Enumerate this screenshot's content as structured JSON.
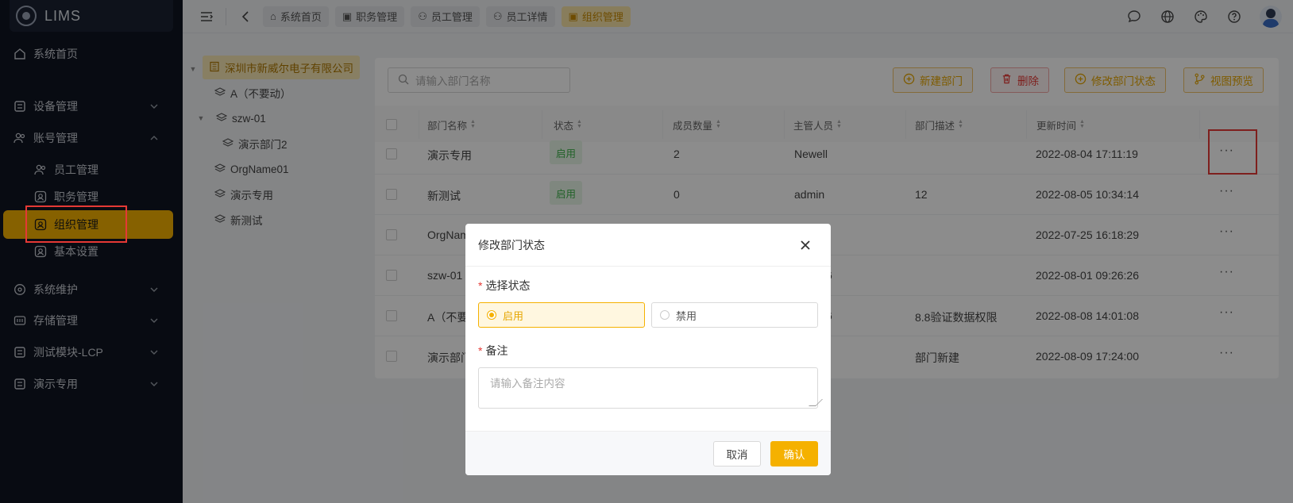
{
  "app": {
    "name": "LIMS"
  },
  "sidebar": {
    "items": [
      {
        "label": "系统首页",
        "icon": "home-icon"
      },
      {
        "label": "设备管理",
        "icon": "grid-icon"
      },
      {
        "label": "账号管理",
        "icon": "users-icon"
      },
      {
        "label": "员工管理",
        "icon": "users-icon"
      },
      {
        "label": "职务管理",
        "icon": "id-card-icon"
      },
      {
        "label": "组织管理",
        "icon": "id-card-icon"
      },
      {
        "label": "基本设置",
        "icon": "id-card-icon"
      },
      {
        "label": "系统维护",
        "icon": "settings-icon"
      },
      {
        "label": "存储管理",
        "icon": "storage-icon"
      },
      {
        "label": "测试模块-LCP",
        "icon": "grid-icon"
      },
      {
        "label": "演示专用",
        "icon": "grid-icon"
      }
    ],
    "active": "组织管理"
  },
  "tabs": [
    {
      "label": "系统首页",
      "icon": "home-icon"
    },
    {
      "label": "职务管理",
      "icon": "id-card-icon"
    },
    {
      "label": "员工管理",
      "icon": "users-icon"
    },
    {
      "label": "员工详情",
      "icon": "users-icon"
    },
    {
      "label": "组织管理",
      "icon": "id-card-icon",
      "active": true
    }
  ],
  "tree": {
    "root": "深圳市新威尔电子有限公司",
    "nodes": [
      "A（不要动）",
      "szw-01",
      "演示部门2",
      "OrgName01",
      "演示专用",
      "新测试"
    ]
  },
  "toolbar": {
    "search_placeholder": "请输入部门名称",
    "new_label": "新建部门",
    "delete_label": "删除",
    "status_label": "修改部门状态",
    "preview_label": "视图预览"
  },
  "table": {
    "headers": [
      "部门名称",
      "状态",
      "成员数量",
      "主管人员",
      "部门描述",
      "更新时间"
    ],
    "rows": [
      {
        "name": "演示专用",
        "status": "启用",
        "count": "2",
        "manager": "Newell",
        "desc": "",
        "time": "2022-08-04 17:11:19"
      },
      {
        "name": "新测试",
        "status": "启用",
        "count": "0",
        "manager": "admin",
        "desc": "12",
        "time": "2022-08-05 10:34:14"
      },
      {
        "name": "OrgNam",
        "status": "",
        "count": "",
        "manager": "",
        "desc": "",
        "time": "2022-07-25 16:18:29"
      },
      {
        "name": "szw-01",
        "status": "",
        "count": "",
        "manager": "6",
        "desc": "",
        "time": "2022-08-01 09:26:26"
      },
      {
        "name": "A（不要",
        "status": "",
        "count": "",
        "manager": "6",
        "desc": "8.8验证数据权限",
        "time": "2022-08-08 14:01:08"
      },
      {
        "name": "演示部门",
        "status": "",
        "count": "",
        "manager": "",
        "desc": "部门新建",
        "time": "2022-08-09 17:24:00"
      }
    ],
    "more_label": "···"
  },
  "modal": {
    "title": "修改部门状态",
    "status_label": "选择状态",
    "enable_label": "启用",
    "disable_label": "禁用",
    "selected": "启用",
    "remark_label": "备注",
    "remark_placeholder": "请输入备注内容",
    "cancel_label": "取消",
    "confirm_label": "确认"
  },
  "colors": {
    "accent": "#f5b100",
    "sidebar_bg": "#0f1421",
    "danger": "#e53935",
    "success": "#3cb34a"
  }
}
